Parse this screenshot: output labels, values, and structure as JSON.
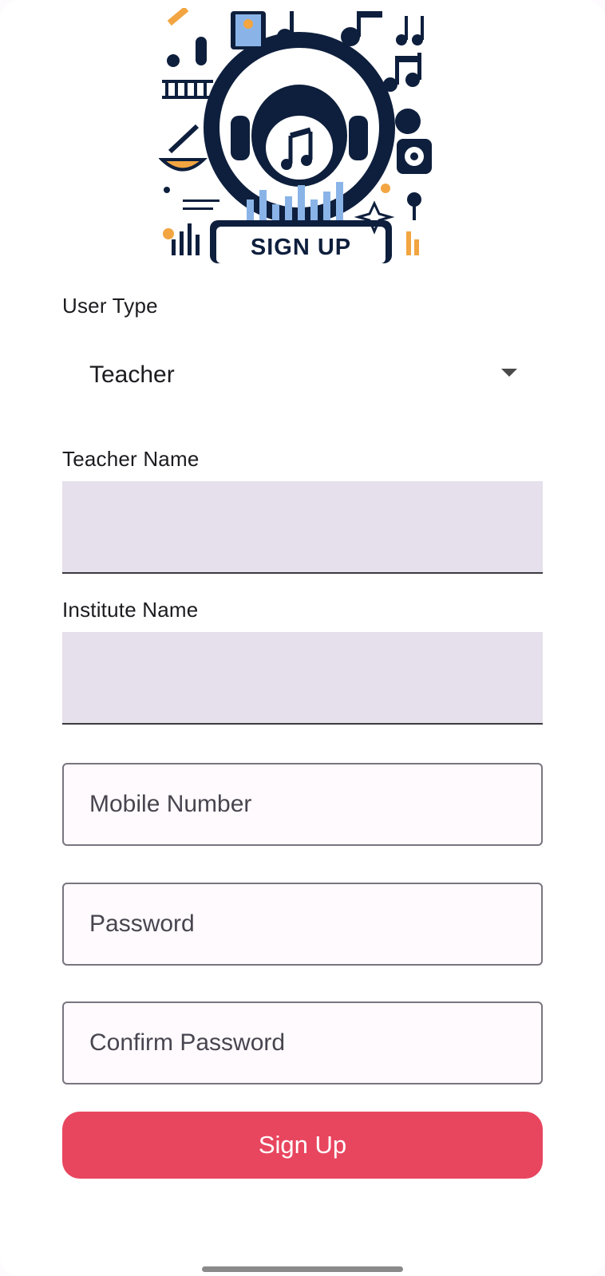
{
  "hero": {
    "caption": "SIGN UP"
  },
  "form": {
    "user_type_label": "User Type",
    "user_type_value": "Teacher",
    "teacher_name_label": "Teacher Name",
    "teacher_name_value": "",
    "institute_name_label": "Institute Name",
    "institute_name_value": "",
    "mobile_placeholder": "Mobile Number",
    "password_placeholder": "Password",
    "confirm_password_placeholder": "Confirm Password",
    "submit_label": "Sign Up"
  },
  "colors": {
    "primary_button": "#e8465f",
    "filled_field": "#e6e0ec",
    "navy": "#0e1f3d",
    "accent_orange": "#f2a541",
    "accent_blue": "#8ab4e8"
  }
}
